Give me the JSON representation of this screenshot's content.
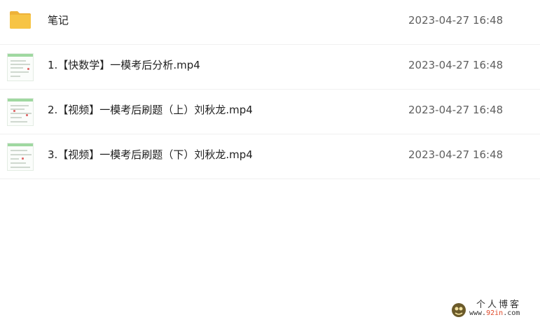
{
  "files": [
    {
      "icon": "folder-icon",
      "name": "笔记",
      "date": "2023-04-27 16:48"
    },
    {
      "icon": "video-thumbnail-icon",
      "name": "1.【快数学】一模考后分析.mp4",
      "date": "2023-04-27 16:48"
    },
    {
      "icon": "video-thumbnail-icon",
      "name": "2.【视频】一模考后刷题（上）刘秋龙.mp4",
      "date": "2023-04-27 16:48"
    },
    {
      "icon": "video-thumbnail-icon",
      "name": "3.【视频】一模考后刷题（下）刘秋龙.mp4",
      "date": "2023-04-27 16:48"
    }
  ],
  "watermark": {
    "title": "个人博客",
    "url_prefix": "www.",
    "url_highlight": "92in",
    "url_suffix": ".com"
  },
  "colors": {
    "folder": "#f7c445",
    "folder_tab": "#eeb23a",
    "text": "#1f1f1f",
    "date": "#5f5f5f",
    "divider": "#f0f0f0",
    "watermark_accent": "#e04a2a"
  }
}
